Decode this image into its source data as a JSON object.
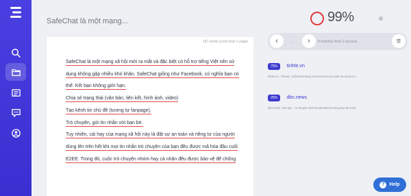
{
  "document": {
    "title": "SafeChat là một mạng...",
    "word_count": "157 words (Less than 1 page)",
    "paragraphs": [
      "SafeChat là một mạng xã hội mới ra mắt và đặc biệt có hỗ trợ tiếng Việt nên sử",
      "dụng không gặp nhiều khó khăn. SafeChat giống như Facebook, có nghĩa bạn có",
      "thể: Kết bạn không giới hạn.",
      "Chia sẻ trạng thái (văn bản, liên kết, hình ảnh, video)",
      "Tạo kênh tin chủ đề (tương tự fanpage).",
      "Trò chuyện, gửi tin nhắn với bạn bè.",
      "Tuy nhiên, cái hay của mạng xã hội này là đặt sự an toàn và riêng tư của người",
      "dùng lên trên hết khi mọi tin nhắn trò chuyện của bạn đều được mã hóa đầu cuối",
      "E2EE. Trong đó, cuộc trò chuyện nhóm hay cá nhân đều được bảo vệ để chống"
    ]
  },
  "score": {
    "value": "99%",
    "info": "?"
  },
  "toolbar": {
    "prev": "‹",
    "dots": "...",
    "next": "›",
    "matches": "8 matches from 2 sources",
    "menu": "≡"
  },
  "results": [
    {
      "percent": "75%",
      "source": "tinhte.vn",
      "url": "tinhte.vn  ›  thread  ›  safechat-mang-xa-hoi-dat-su-an-toan-va-rieng-tu-c..."
    },
    {
      "percent": "25%",
      "source": "dkn.news",
      "url": "dkn.news  ›  the-gioi  ›  co-tat-giai-minh-facebookvoa-trang-dua-tin-zuck..."
    }
  ],
  "help": {
    "label": "Help",
    "icon": "?"
  },
  "colors": {
    "accent": "#3e3bd0",
    "error": "#e04848",
    "help": "#2f6fd6"
  },
  "icons": [
    "logo-icon",
    "search-icon",
    "folder-icon",
    "document-list-icon",
    "chat-icon",
    "account-icon"
  ]
}
